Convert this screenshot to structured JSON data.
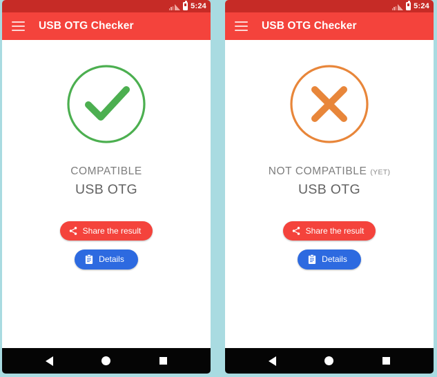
{
  "theme": {
    "page_background": "#a9dbe1",
    "statusbar_color": "#c62b26",
    "appbar_color": "#f4433c",
    "share_button_color": "#f4433c",
    "details_button_color": "#2d6ae0",
    "compatible_color": "#4caf50",
    "not_compatible_color": "#e8863a",
    "label_color": "#7d7d7d",
    "navbar_color": "#050505"
  },
  "statusbar": {
    "time": "5:24",
    "signal_icon": "signal-bars-icon",
    "battery_icon": "battery-icon"
  },
  "appbar": {
    "menu_icon": "hamburger-menu-icon",
    "title": "USB OTG Checker"
  },
  "panels": [
    {
      "id": "compatible-panel",
      "result_icon": "check-circle-icon",
      "result_color": "#4caf50",
      "status_label": "COMPATIBLE",
      "status_note": "",
      "feature_label": "USB OTG",
      "share_button": {
        "label": "Share the result",
        "icon": "share-icon"
      },
      "details_button": {
        "label": "Details",
        "icon": "clipboard-icon"
      }
    },
    {
      "id": "not-compatible-panel",
      "result_icon": "x-circle-icon",
      "result_color": "#e8863a",
      "status_label": "NOT COMPATIBLE",
      "status_note": "(YET)",
      "feature_label": "USB OTG",
      "share_button": {
        "label": "Share the result",
        "icon": "share-icon"
      },
      "details_button": {
        "label": "Details",
        "icon": "clipboard-icon"
      }
    }
  ],
  "navbar": {
    "back_icon": "back-triangle-icon",
    "home_icon": "home-circle-icon",
    "recents_icon": "recents-square-icon"
  }
}
